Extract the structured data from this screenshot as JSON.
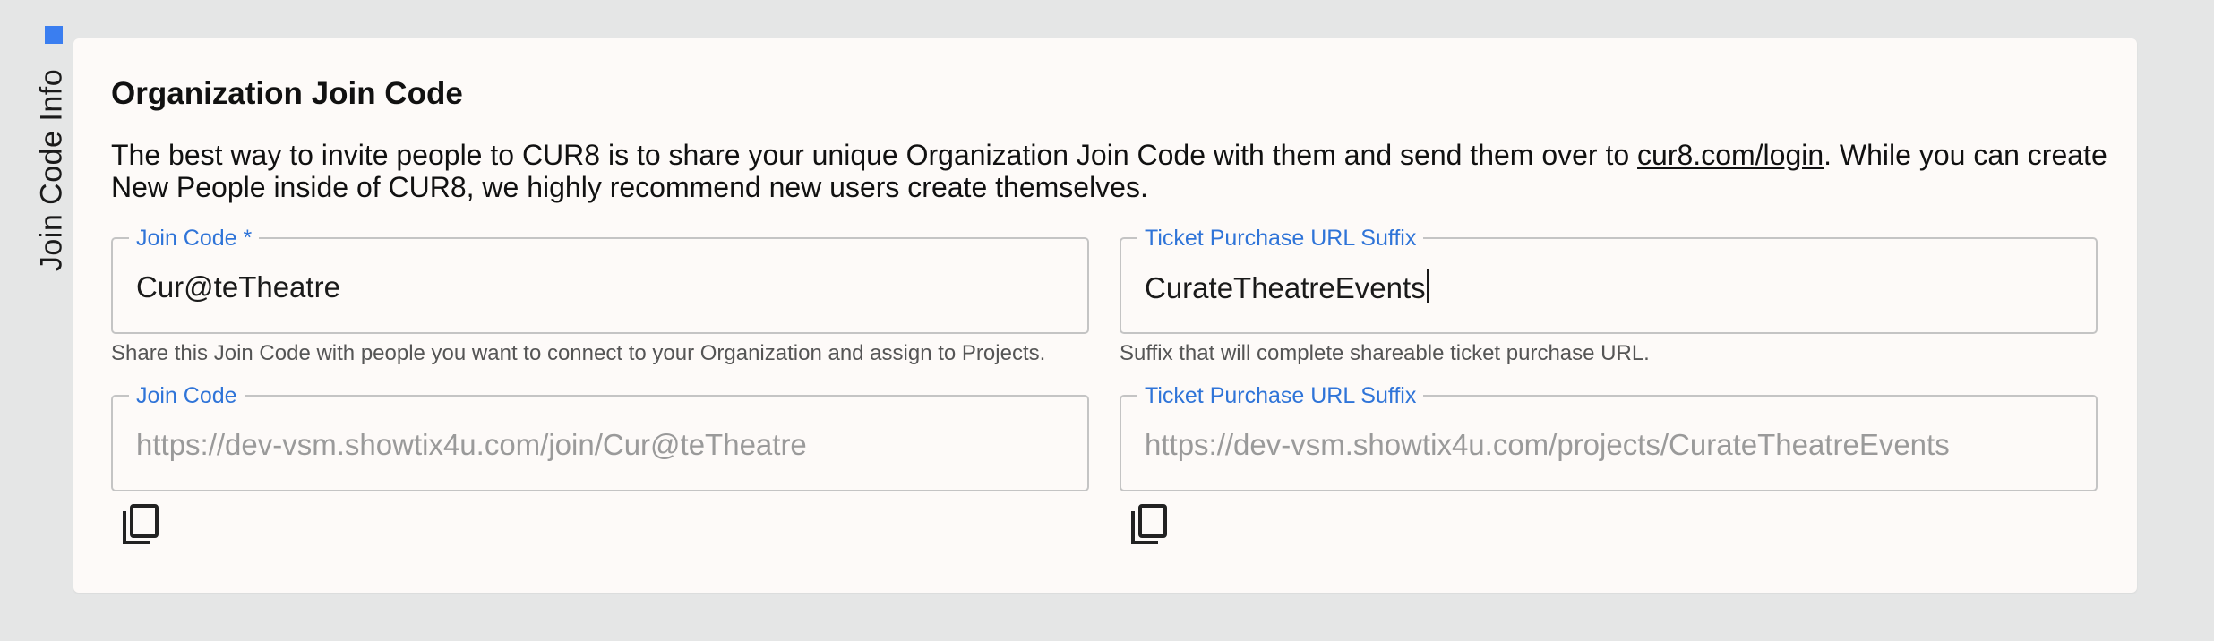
{
  "section": {
    "side_label": "Join Code Info",
    "marker_color": "#3a7ef0"
  },
  "card": {
    "title": "Organization Join Code",
    "intro": {
      "before_link": "The best way to invite people to CUR8 is to share your unique Organization Join Code with them and send them over to ",
      "link_text": "cur8.com/login",
      "after_link": ". While you can create New People inside of CUR8, we highly recommend new users create themselves."
    },
    "join_code_field": {
      "label": "Join Code *",
      "value": "Cur@teTheatre",
      "helper": "Share this Join Code with people you want to connect to your Organization and assign to Projects."
    },
    "ticket_suffix_field": {
      "label": "Ticket Purchase URL Suffix",
      "value": "CurateTheatreEvents",
      "helper": "Suffix that will complete shareable ticket purchase URL."
    },
    "join_url_field": {
      "label": "Join Code",
      "value": "https://dev-vsm.showtix4u.com/join/Cur@teTheatre"
    },
    "ticket_url_field": {
      "label": "Ticket Purchase URL Suffix",
      "value": "https://dev-vsm.showtix4u.com/projects/CurateTheatreEvents"
    },
    "copy_icon": "copy-icon"
  },
  "colors": {
    "accent": "#2f74d8",
    "background": "#e5e6e6",
    "card": "#fdfaf8"
  }
}
